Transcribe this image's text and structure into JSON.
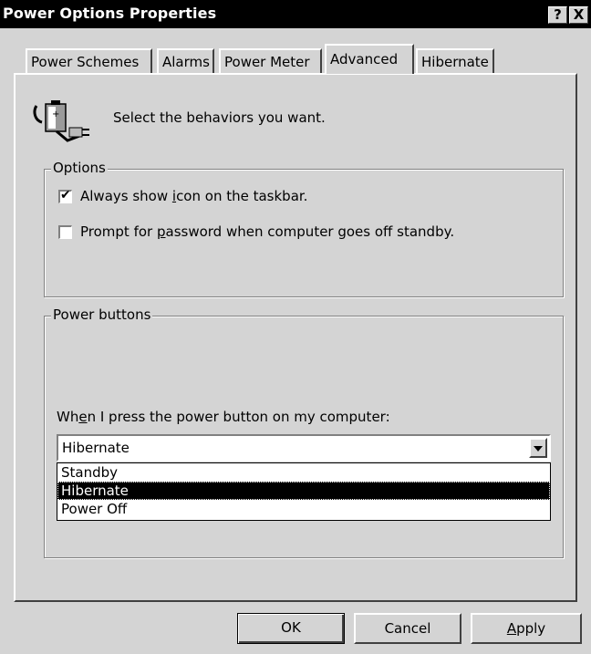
{
  "window": {
    "title": "Power Options Properties",
    "help_btn": "?",
    "close_btn": "X"
  },
  "tabs": [
    {
      "label": "Power Schemes"
    },
    {
      "label": "Alarms"
    },
    {
      "label": "Power Meter"
    },
    {
      "label": "Advanced"
    },
    {
      "label": "Hibernate"
    }
  ],
  "header": {
    "text": "Select the behaviors you want.",
    "icon": "power-plug-battery-icon"
  },
  "options": {
    "legend": "Options",
    "always_show_icon": {
      "label_pre": "Always show ",
      "label_ul": "i",
      "label_post": "con on the taskbar.",
      "checked": true
    },
    "prompt_password": {
      "label_pre": "Prompt for ",
      "label_ul": "p",
      "label_post": "assword when computer goes off standby.",
      "checked": false
    }
  },
  "power_buttons": {
    "legend": "Power buttons",
    "prompt_pre": "Wh",
    "prompt_ul": "e",
    "prompt_post": "n I press the power button on my computer:",
    "selected": "Hibernate",
    "options": [
      "Standby",
      "Hibernate",
      "Power Off"
    ]
  },
  "buttons": {
    "ok": "OK",
    "cancel": "Cancel",
    "apply_ul": "A",
    "apply_rest": "pply"
  }
}
